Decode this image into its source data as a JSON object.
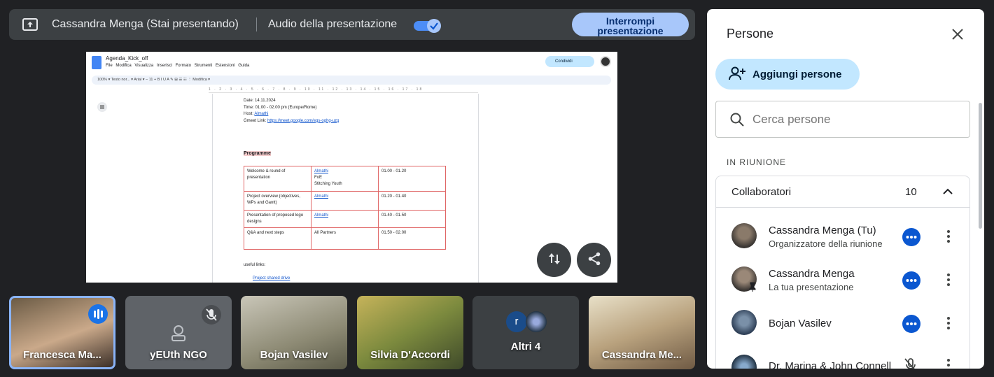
{
  "topbar": {
    "presenter": "Cassandra Menga (Stai presentando)",
    "audio_label": "Audio della presentazione",
    "audio_on": true,
    "stop_line1": "Interrompi",
    "stop_line2": "presentazione"
  },
  "doc": {
    "title": "Agenda_Kick_off",
    "menu": "File Modifica Visualizza Inserisci Formato Strumenti Estensioni Guida",
    "toolbar": "100%  ▾   Testo nor... ▾   Arial ▾   −  11  +   B  I  U  A   ✎   ⊞  ☰  ☷  ⋮   Modifica ▾",
    "share_label": "Condividi",
    "ruler": "1 · 2 · 3 · 4 · 5 · 6 · 7 · 8 · 9 · 10 · 11 · 12 · 13 · 14 · 15 · 16 · 17 · 18",
    "date": "Date: 14.11.2024",
    "time": "Time: 01.00 - 02.00 pm (Europe/Rome)",
    "host_prefix": "Host: ",
    "host": "Almathi",
    "link_prefix": "Gmeet Link: ",
    "link": "https://meet.google.com/egs-oghg-uzg",
    "programme": "Programme",
    "rows": [
      {
        "activity": "Welcome & round of presentation",
        "who": [
          "Almathi",
          "FoE",
          "Stitching Youth"
        ],
        "time": "01.00 - 01.20"
      },
      {
        "activity": "Project overview (objectives, WPs and Gantt)",
        "who": [
          "Almathi"
        ],
        "time": "01.20 - 01.40"
      },
      {
        "activity": "Presentation of proposed logo designs",
        "who": [
          "Almathi"
        ],
        "time": "01.40 - 01.50"
      },
      {
        "activity": "Q&A and next steps",
        "who": [
          "All Partners"
        ],
        "time": "01.50 - 02.00"
      }
    ],
    "useful_links": "useful links:",
    "drive_link": "Project shared drive"
  },
  "tiles": [
    {
      "name": "Francesca Ma...",
      "speaking": true
    },
    {
      "name": "yEUth NGO",
      "muted": true
    },
    {
      "name": "Bojan Vasilev"
    },
    {
      "name": "Silvia D'Accordi"
    },
    {
      "name": "Altri 4",
      "avatar_letter": "r"
    },
    {
      "name": "Cassandra Me..."
    }
  ],
  "panel": {
    "title": "Persone",
    "add_label": "Aggiungi persone",
    "search_placeholder": "Cerca persone",
    "section": "IN RIUNIONE",
    "group_label": "Collaboratori",
    "group_count": "10",
    "people": [
      {
        "name": "Cassandra Menga (Tu)",
        "sub": "Organizzatore della riunione"
      },
      {
        "name": "Cassandra Menga",
        "sub": "La tua presentazione"
      },
      {
        "name": "Bojan Vasilev",
        "sub": ""
      },
      {
        "name": "Dr. Marina & John Connell",
        "sub": ""
      }
    ]
  },
  "colors": {
    "accent": "#0b57d0",
    "stop_bg": "#a8c7fa",
    "add_bg": "#c2e7ff",
    "tile_active": "#8ab4f8"
  }
}
